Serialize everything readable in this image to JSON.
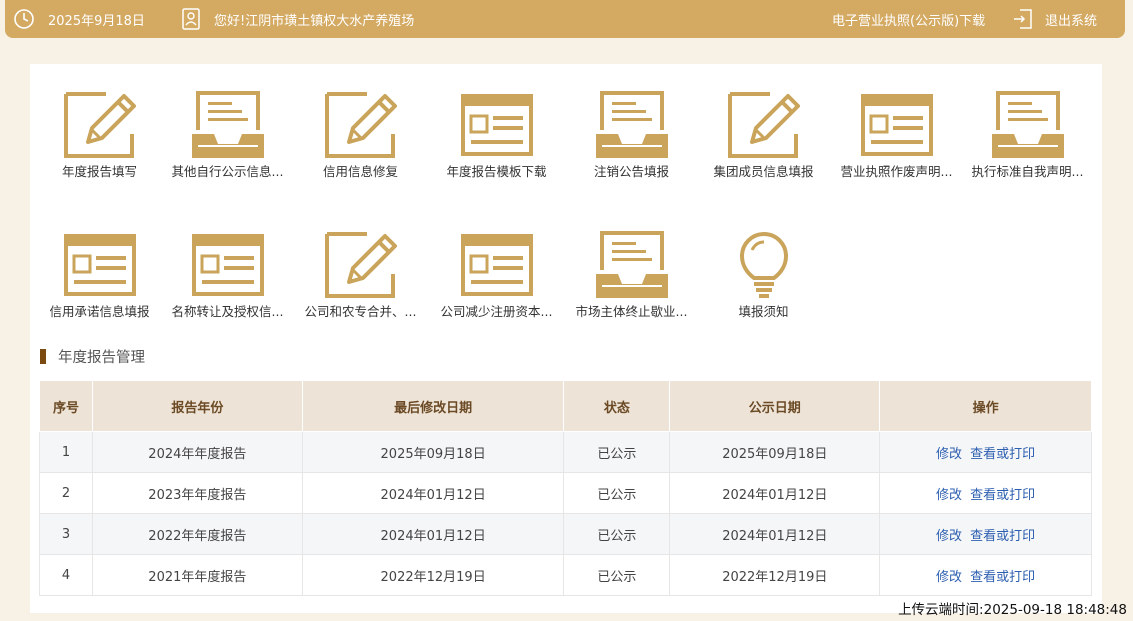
{
  "header": {
    "date": "2025年9月18日",
    "greeting": "您好!江阴市璜土镇权大水产养殖场",
    "license_download": "电子营业执照(公示版)下载",
    "logout": "退出系统"
  },
  "tiles": [
    {
      "label": "年度报告填写",
      "icon": "pencil-edit-icon"
    },
    {
      "label": "其他自行公示信息...",
      "icon": "inbox-tray-icon"
    },
    {
      "label": "信用信息修复",
      "icon": "pencil-edit-icon"
    },
    {
      "label": "年度报告模板下载",
      "icon": "form-template-icon"
    },
    {
      "label": "注销公告填报",
      "icon": "inbox-tray-icon"
    },
    {
      "label": "集团成员信息填报",
      "icon": "pencil-edit-icon"
    },
    {
      "label": "营业执照作废声明...",
      "icon": "form-template-icon"
    },
    {
      "label": "执行标准自我声明...",
      "icon": "inbox-tray-icon"
    },
    {
      "label": "信用承诺信息填报",
      "icon": "form-template-icon"
    },
    {
      "label": "名称转让及授权信...",
      "icon": "form-template-icon"
    },
    {
      "label": "公司和农专合并、...",
      "icon": "pencil-edit-icon"
    },
    {
      "label": "公司减少注册资本...",
      "icon": "form-template-icon"
    },
    {
      "label": "市场主体终止歇业...",
      "icon": "inbox-tray-icon"
    },
    {
      "label": "填报须知",
      "icon": "lightbulb-icon"
    }
  ],
  "section_title": "年度报告管理",
  "table": {
    "headers": [
      "序号",
      "报告年份",
      "最后修改日期",
      "状态",
      "公示日期",
      "操作"
    ],
    "rows": [
      {
        "no": "1",
        "year": "2024年年度报告",
        "modified": "2025年09月18日",
        "status": "已公示",
        "published": "2025年09月18日"
      },
      {
        "no": "2",
        "year": "2023年年度报告",
        "modified": "2024年01月12日",
        "status": "已公示",
        "published": "2024年01月12日"
      },
      {
        "no": "3",
        "year": "2022年年度报告",
        "modified": "2024年01月12日",
        "status": "已公示",
        "published": "2024年01月12日"
      },
      {
        "no": "4",
        "year": "2021年年度报告",
        "modified": "2022年12月19日",
        "status": "已公示",
        "published": "2022年12月19日"
      }
    ],
    "edit_label": "修改",
    "view_label": "查看或打印"
  },
  "upload_time": "上传云端时间:2025-09-18 18:48:48",
  "colors": {
    "brand": "#d4aa63",
    "accent_dark": "#7b4a10",
    "link": "#2d5fb0"
  }
}
